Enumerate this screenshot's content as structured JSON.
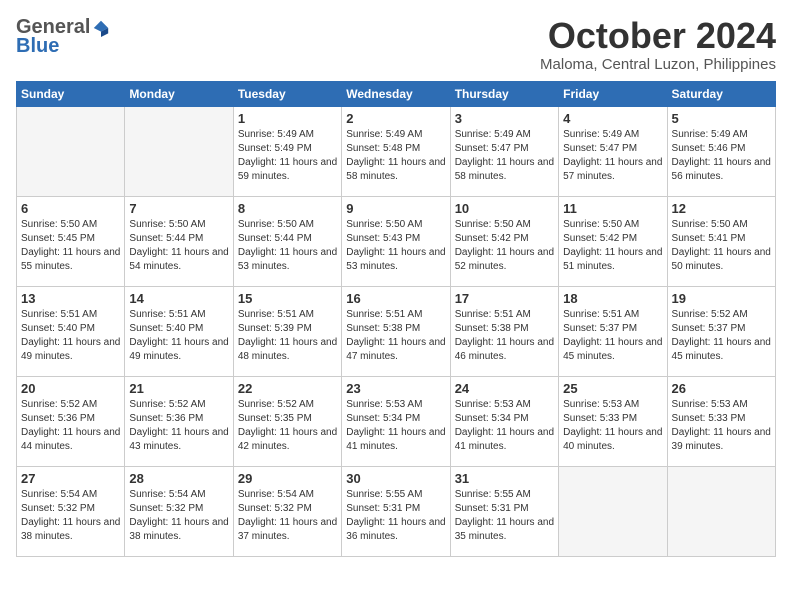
{
  "header": {
    "logo_general": "General",
    "logo_blue": "Blue",
    "month": "October 2024",
    "location": "Maloma, Central Luzon, Philippines"
  },
  "weekdays": [
    "Sunday",
    "Monday",
    "Tuesday",
    "Wednesday",
    "Thursday",
    "Friday",
    "Saturday"
  ],
  "weeks": [
    [
      {
        "day": "",
        "sunrise": "",
        "sunset": "",
        "daylight": ""
      },
      {
        "day": "",
        "sunrise": "",
        "sunset": "",
        "daylight": ""
      },
      {
        "day": "1",
        "sunrise": "Sunrise: 5:49 AM",
        "sunset": "Sunset: 5:49 PM",
        "daylight": "Daylight: 11 hours and 59 minutes."
      },
      {
        "day": "2",
        "sunrise": "Sunrise: 5:49 AM",
        "sunset": "Sunset: 5:48 PM",
        "daylight": "Daylight: 11 hours and 58 minutes."
      },
      {
        "day": "3",
        "sunrise": "Sunrise: 5:49 AM",
        "sunset": "Sunset: 5:47 PM",
        "daylight": "Daylight: 11 hours and 58 minutes."
      },
      {
        "day": "4",
        "sunrise": "Sunrise: 5:49 AM",
        "sunset": "Sunset: 5:47 PM",
        "daylight": "Daylight: 11 hours and 57 minutes."
      },
      {
        "day": "5",
        "sunrise": "Sunrise: 5:49 AM",
        "sunset": "Sunset: 5:46 PM",
        "daylight": "Daylight: 11 hours and 56 minutes."
      }
    ],
    [
      {
        "day": "6",
        "sunrise": "Sunrise: 5:50 AM",
        "sunset": "Sunset: 5:45 PM",
        "daylight": "Daylight: 11 hours and 55 minutes."
      },
      {
        "day": "7",
        "sunrise": "Sunrise: 5:50 AM",
        "sunset": "Sunset: 5:44 PM",
        "daylight": "Daylight: 11 hours and 54 minutes."
      },
      {
        "day": "8",
        "sunrise": "Sunrise: 5:50 AM",
        "sunset": "Sunset: 5:44 PM",
        "daylight": "Daylight: 11 hours and 53 minutes."
      },
      {
        "day": "9",
        "sunrise": "Sunrise: 5:50 AM",
        "sunset": "Sunset: 5:43 PM",
        "daylight": "Daylight: 11 hours and 53 minutes."
      },
      {
        "day": "10",
        "sunrise": "Sunrise: 5:50 AM",
        "sunset": "Sunset: 5:42 PM",
        "daylight": "Daylight: 11 hours and 52 minutes."
      },
      {
        "day": "11",
        "sunrise": "Sunrise: 5:50 AM",
        "sunset": "Sunset: 5:42 PM",
        "daylight": "Daylight: 11 hours and 51 minutes."
      },
      {
        "day": "12",
        "sunrise": "Sunrise: 5:50 AM",
        "sunset": "Sunset: 5:41 PM",
        "daylight": "Daylight: 11 hours and 50 minutes."
      }
    ],
    [
      {
        "day": "13",
        "sunrise": "Sunrise: 5:51 AM",
        "sunset": "Sunset: 5:40 PM",
        "daylight": "Daylight: 11 hours and 49 minutes."
      },
      {
        "day": "14",
        "sunrise": "Sunrise: 5:51 AM",
        "sunset": "Sunset: 5:40 PM",
        "daylight": "Daylight: 11 hours and 49 minutes."
      },
      {
        "day": "15",
        "sunrise": "Sunrise: 5:51 AM",
        "sunset": "Sunset: 5:39 PM",
        "daylight": "Daylight: 11 hours and 48 minutes."
      },
      {
        "day": "16",
        "sunrise": "Sunrise: 5:51 AM",
        "sunset": "Sunset: 5:38 PM",
        "daylight": "Daylight: 11 hours and 47 minutes."
      },
      {
        "day": "17",
        "sunrise": "Sunrise: 5:51 AM",
        "sunset": "Sunset: 5:38 PM",
        "daylight": "Daylight: 11 hours and 46 minutes."
      },
      {
        "day": "18",
        "sunrise": "Sunrise: 5:51 AM",
        "sunset": "Sunset: 5:37 PM",
        "daylight": "Daylight: 11 hours and 45 minutes."
      },
      {
        "day": "19",
        "sunrise": "Sunrise: 5:52 AM",
        "sunset": "Sunset: 5:37 PM",
        "daylight": "Daylight: 11 hours and 45 minutes."
      }
    ],
    [
      {
        "day": "20",
        "sunrise": "Sunrise: 5:52 AM",
        "sunset": "Sunset: 5:36 PM",
        "daylight": "Daylight: 11 hours and 44 minutes."
      },
      {
        "day": "21",
        "sunrise": "Sunrise: 5:52 AM",
        "sunset": "Sunset: 5:36 PM",
        "daylight": "Daylight: 11 hours and 43 minutes."
      },
      {
        "day": "22",
        "sunrise": "Sunrise: 5:52 AM",
        "sunset": "Sunset: 5:35 PM",
        "daylight": "Daylight: 11 hours and 42 minutes."
      },
      {
        "day": "23",
        "sunrise": "Sunrise: 5:53 AM",
        "sunset": "Sunset: 5:34 PM",
        "daylight": "Daylight: 11 hours and 41 minutes."
      },
      {
        "day": "24",
        "sunrise": "Sunrise: 5:53 AM",
        "sunset": "Sunset: 5:34 PM",
        "daylight": "Daylight: 11 hours and 41 minutes."
      },
      {
        "day": "25",
        "sunrise": "Sunrise: 5:53 AM",
        "sunset": "Sunset: 5:33 PM",
        "daylight": "Daylight: 11 hours and 40 minutes."
      },
      {
        "day": "26",
        "sunrise": "Sunrise: 5:53 AM",
        "sunset": "Sunset: 5:33 PM",
        "daylight": "Daylight: 11 hours and 39 minutes."
      }
    ],
    [
      {
        "day": "27",
        "sunrise": "Sunrise: 5:54 AM",
        "sunset": "Sunset: 5:32 PM",
        "daylight": "Daylight: 11 hours and 38 minutes."
      },
      {
        "day": "28",
        "sunrise": "Sunrise: 5:54 AM",
        "sunset": "Sunset: 5:32 PM",
        "daylight": "Daylight: 11 hours and 38 minutes."
      },
      {
        "day": "29",
        "sunrise": "Sunrise: 5:54 AM",
        "sunset": "Sunset: 5:32 PM",
        "daylight": "Daylight: 11 hours and 37 minutes."
      },
      {
        "day": "30",
        "sunrise": "Sunrise: 5:55 AM",
        "sunset": "Sunset: 5:31 PM",
        "daylight": "Daylight: 11 hours and 36 minutes."
      },
      {
        "day": "31",
        "sunrise": "Sunrise: 5:55 AM",
        "sunset": "Sunset: 5:31 PM",
        "daylight": "Daylight: 11 hours and 35 minutes."
      },
      {
        "day": "",
        "sunrise": "",
        "sunset": "",
        "daylight": ""
      },
      {
        "day": "",
        "sunrise": "",
        "sunset": "",
        "daylight": ""
      }
    ]
  ]
}
